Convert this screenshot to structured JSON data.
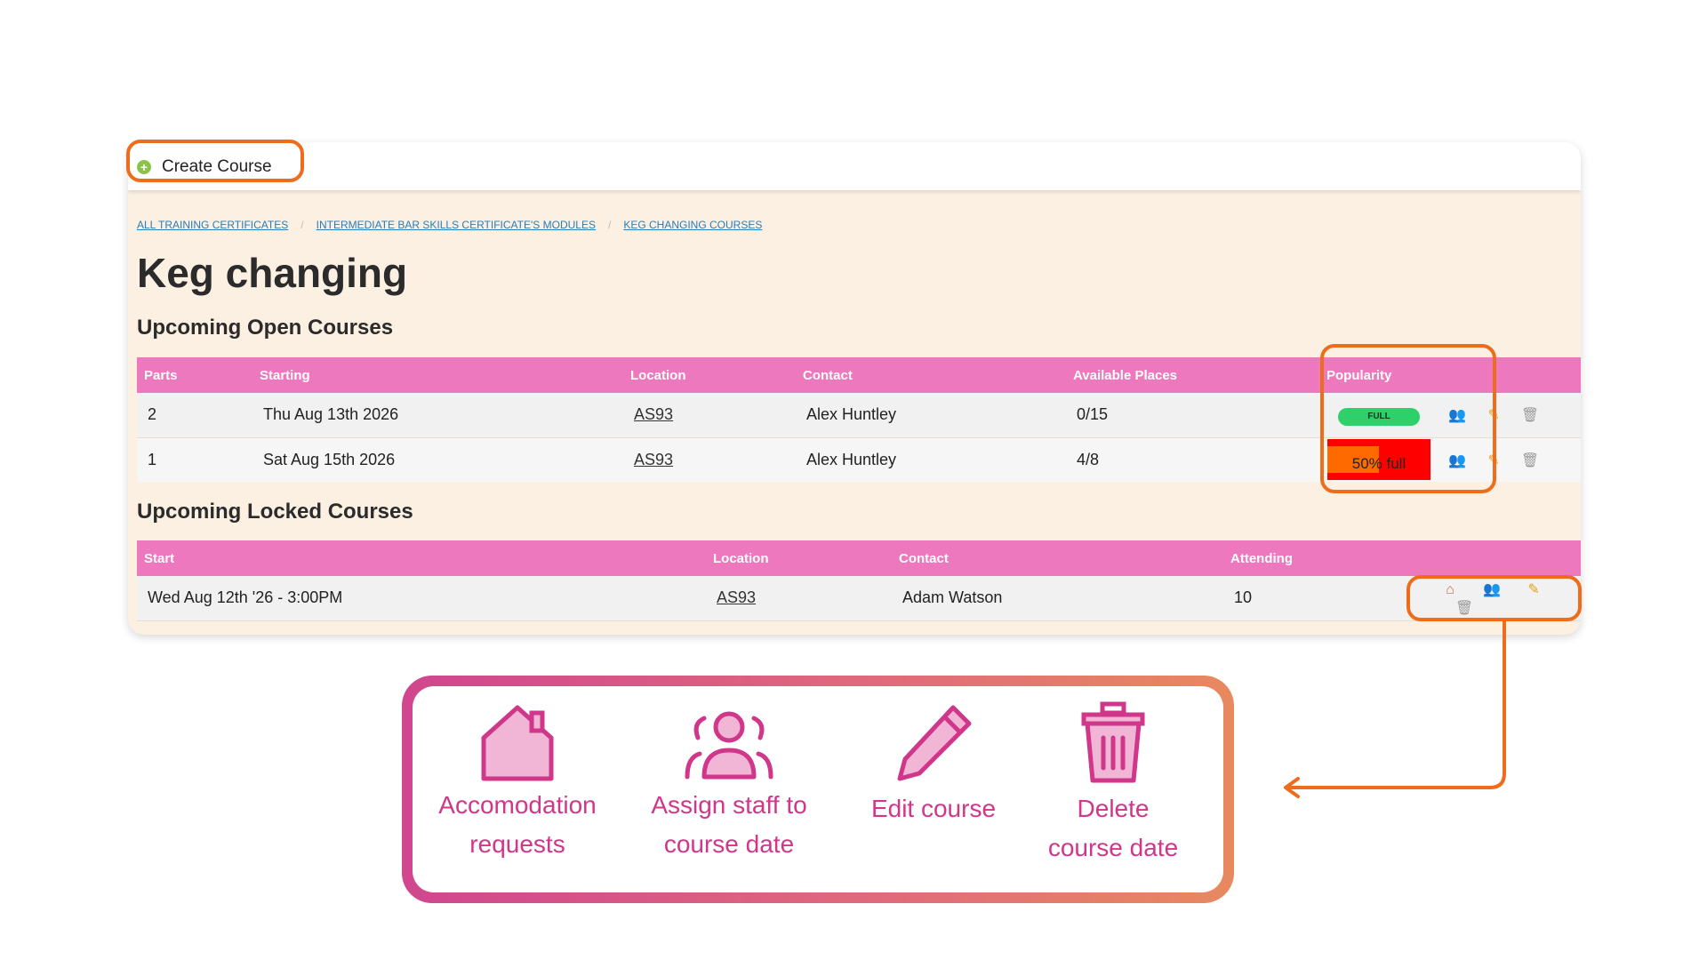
{
  "toolbar": {
    "create_label": "Create Course"
  },
  "breadcrumb": [
    "ALL TRAINING CERTIFICATES",
    "INTERMEDIATE BAR SKILLS CERTIFICATE'S MODULES",
    "KEG CHANGING COURSES"
  ],
  "page_title": "Keg changing",
  "open_courses": {
    "title": "Upcoming Open Courses",
    "headers": [
      "Parts",
      "Starting",
      "Location",
      "Contact",
      "Available Places",
      "Popularity"
    ],
    "rows": [
      {
        "parts": "2",
        "starting": "Thu Aug 13th 2026",
        "location": "AS93",
        "contact": "Alex Huntley",
        "places": "0/15",
        "popularity": "FULL"
      },
      {
        "parts": "1",
        "starting": "Sat Aug 15th 2026",
        "location": "AS93",
        "contact": "Alex Huntley",
        "places": "4/8",
        "popularity": "50% full",
        "popularity_fraction": 0.5
      }
    ]
  },
  "locked_courses": {
    "title": "Upcoming Locked Courses",
    "headers": [
      "Start",
      "Location",
      "Contact",
      "Attending"
    ],
    "rows": [
      {
        "start": "Wed Aug 12th '26 - 3:00PM",
        "location": "AS93",
        "contact": "Adam Watson",
        "attending": "10"
      }
    ]
  },
  "legend": {
    "accommodation": [
      "Accomodation",
      "requests"
    ],
    "assign": [
      "Assign staff to",
      "course date"
    ],
    "edit": [
      "Edit course"
    ],
    "delete": [
      "Delete",
      "course date"
    ]
  },
  "icons": [
    "plus-circle-icon",
    "house-icon",
    "staff-icon",
    "pencil-icon",
    "trash-icon"
  ],
  "colors": {
    "header_pink": "#ee78be",
    "highlight_orange": "#ee6d1c",
    "legend_pink": "#d0368a",
    "full_green": "#2ed06a",
    "bar_red": "#ff0000"
  }
}
